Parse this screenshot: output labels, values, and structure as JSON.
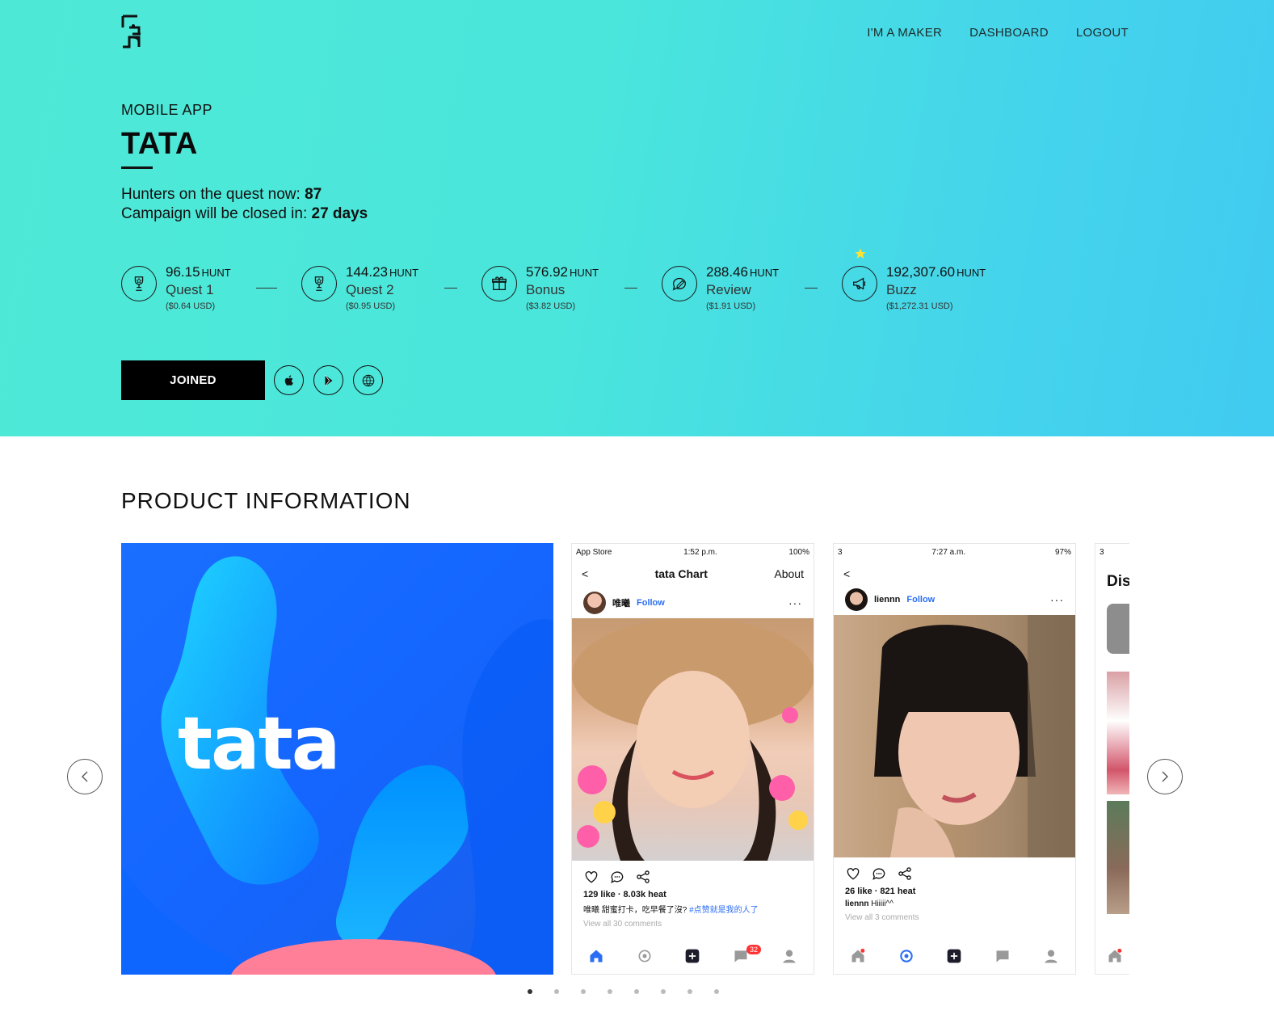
{
  "nav": {
    "items": [
      "I'M A MAKER",
      "DASHBOARD",
      "LOGOUT"
    ]
  },
  "hero": {
    "category": "MOBILE APP",
    "title": "TATA",
    "hunters_label": "Hunters on the quest now: ",
    "hunters_value": "87",
    "closed_label": "Campaign will be closed in: ",
    "closed_value": "27 days"
  },
  "quests": [
    {
      "amount": "96.15",
      "unit": "HUNT",
      "name": "Quest 1",
      "usd": "($0.64 USD)",
      "icon": "trophy-icon"
    },
    {
      "amount": "144.23",
      "unit": "HUNT",
      "name": "Quest 2",
      "usd": "($0.95 USD)",
      "icon": "trophy-icon"
    },
    {
      "amount": "576.92",
      "unit": "HUNT",
      "name": "Bonus",
      "usd": "($3.82 USD)",
      "icon": "gift-icon"
    },
    {
      "amount": "288.46",
      "unit": "HUNT",
      "name": "Review",
      "usd": "($1.91 USD)",
      "icon": "chat-pen-icon"
    },
    {
      "amount": "192,307.60",
      "unit": "HUNT",
      "name": "Buzz",
      "usd": "($1,272.31 USD)",
      "icon": "megaphone-icon"
    }
  ],
  "actions": {
    "join_label": "JOINED",
    "icons": [
      "apple-icon",
      "google-play-icon",
      "globe-icon"
    ]
  },
  "product": {
    "section_title": "PRODUCT INFORMATION",
    "logo_text": "tata",
    "screen1": {
      "status_left": "App Store",
      "status_time": "1:52 p.m.",
      "status_right": "100%",
      "back": "<",
      "title": "tata Chart",
      "about": "About",
      "user": "唯曦",
      "follow": "Follow",
      "stats": "129 like · 8.03k heat",
      "caption": "唯曦 甜蜜打卡，吃早餐了沒?",
      "hashtag": "#点赞就是我的人了",
      "view_all": "View all 30 comments",
      "badge": "32"
    },
    "screen2": {
      "status_left": "3",
      "status_time": "7:27 a.m.",
      "status_right": "97%",
      "user": "liennn",
      "follow": "Follow",
      "stats": "26 like · 821 heat",
      "caption_user": "liennn",
      "caption": " Hiiiii^^",
      "view_all": "View all 3 comments"
    },
    "screen3": {
      "status_left": "3",
      "title_partial": "Dis"
    }
  },
  "carousel": {
    "dot_count": 8,
    "active_index": 0
  },
  "colors": {
    "hero_start": "#4ee9d6",
    "hero_end": "#40cbf0",
    "link_blue": "#2b6ef5"
  }
}
